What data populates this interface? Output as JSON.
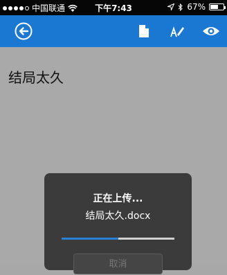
{
  "status_bar": {
    "carrier": "中国联通",
    "time": "下午7:43",
    "battery_text": "67%",
    "battery_level": 0.67,
    "signal_bars_filled": 4,
    "signal_bars_total": 5
  },
  "app_bar": {
    "color": "#1a78d2",
    "icons": [
      "back-icon",
      "document-icon",
      "edit-icon",
      "view-icon"
    ]
  },
  "document": {
    "title": "结局太久"
  },
  "upload_dialog": {
    "title": "正在上传...",
    "file_name": "结局太久.docx",
    "progress": 0.5,
    "cancel_label": "取消"
  }
}
